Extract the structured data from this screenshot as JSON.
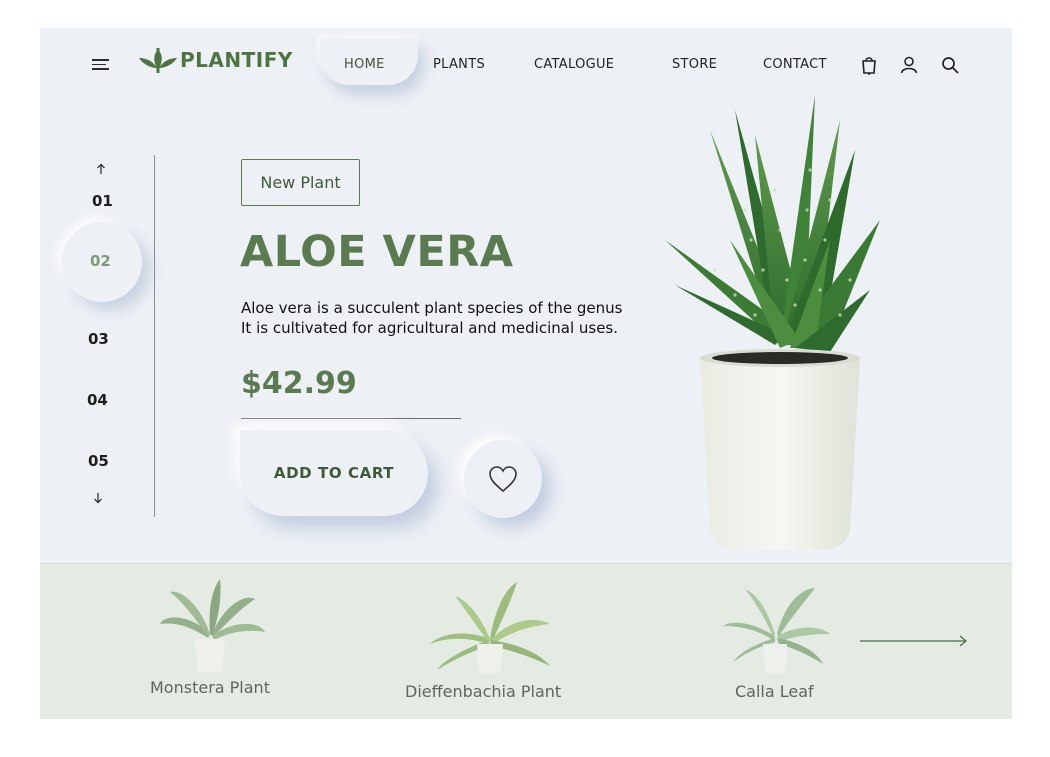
{
  "brand": {
    "name": "PLANTIFY",
    "color": "#4e7442"
  },
  "nav": {
    "items": [
      {
        "label": "HOME",
        "active": true
      },
      {
        "label": "PLANTS",
        "active": false
      },
      {
        "label": "CATALOGUE",
        "active": false
      },
      {
        "label": "STORE",
        "active": false
      },
      {
        "label": "CONTACT",
        "active": false
      }
    ],
    "icons": [
      "cart-icon",
      "user-icon",
      "search-icon"
    ]
  },
  "slider": {
    "items": [
      "01",
      "02",
      "03",
      "04",
      "05"
    ],
    "active_index": 1
  },
  "hero": {
    "badge": "New Plant",
    "title": "ALOE VERA",
    "description_lines": [
      "Aloe vera is a succulent plant species of the genus",
      "It is cultivated for agricultural and medicinal uses."
    ],
    "price": "$42.99",
    "add_to_cart": "ADD TO CART",
    "favorite_icon": "heart-icon"
  },
  "related": {
    "items": [
      {
        "name": "Monstera Plant"
      },
      {
        "name": "Dieffenbachia  Plant"
      },
      {
        "name": "Calla Leaf"
      }
    ],
    "next_icon": "arrow-right-icon"
  },
  "colors": {
    "accent_green": "#5a7a50",
    "background": "#edf0f5",
    "strip": "#e3ebe3"
  }
}
